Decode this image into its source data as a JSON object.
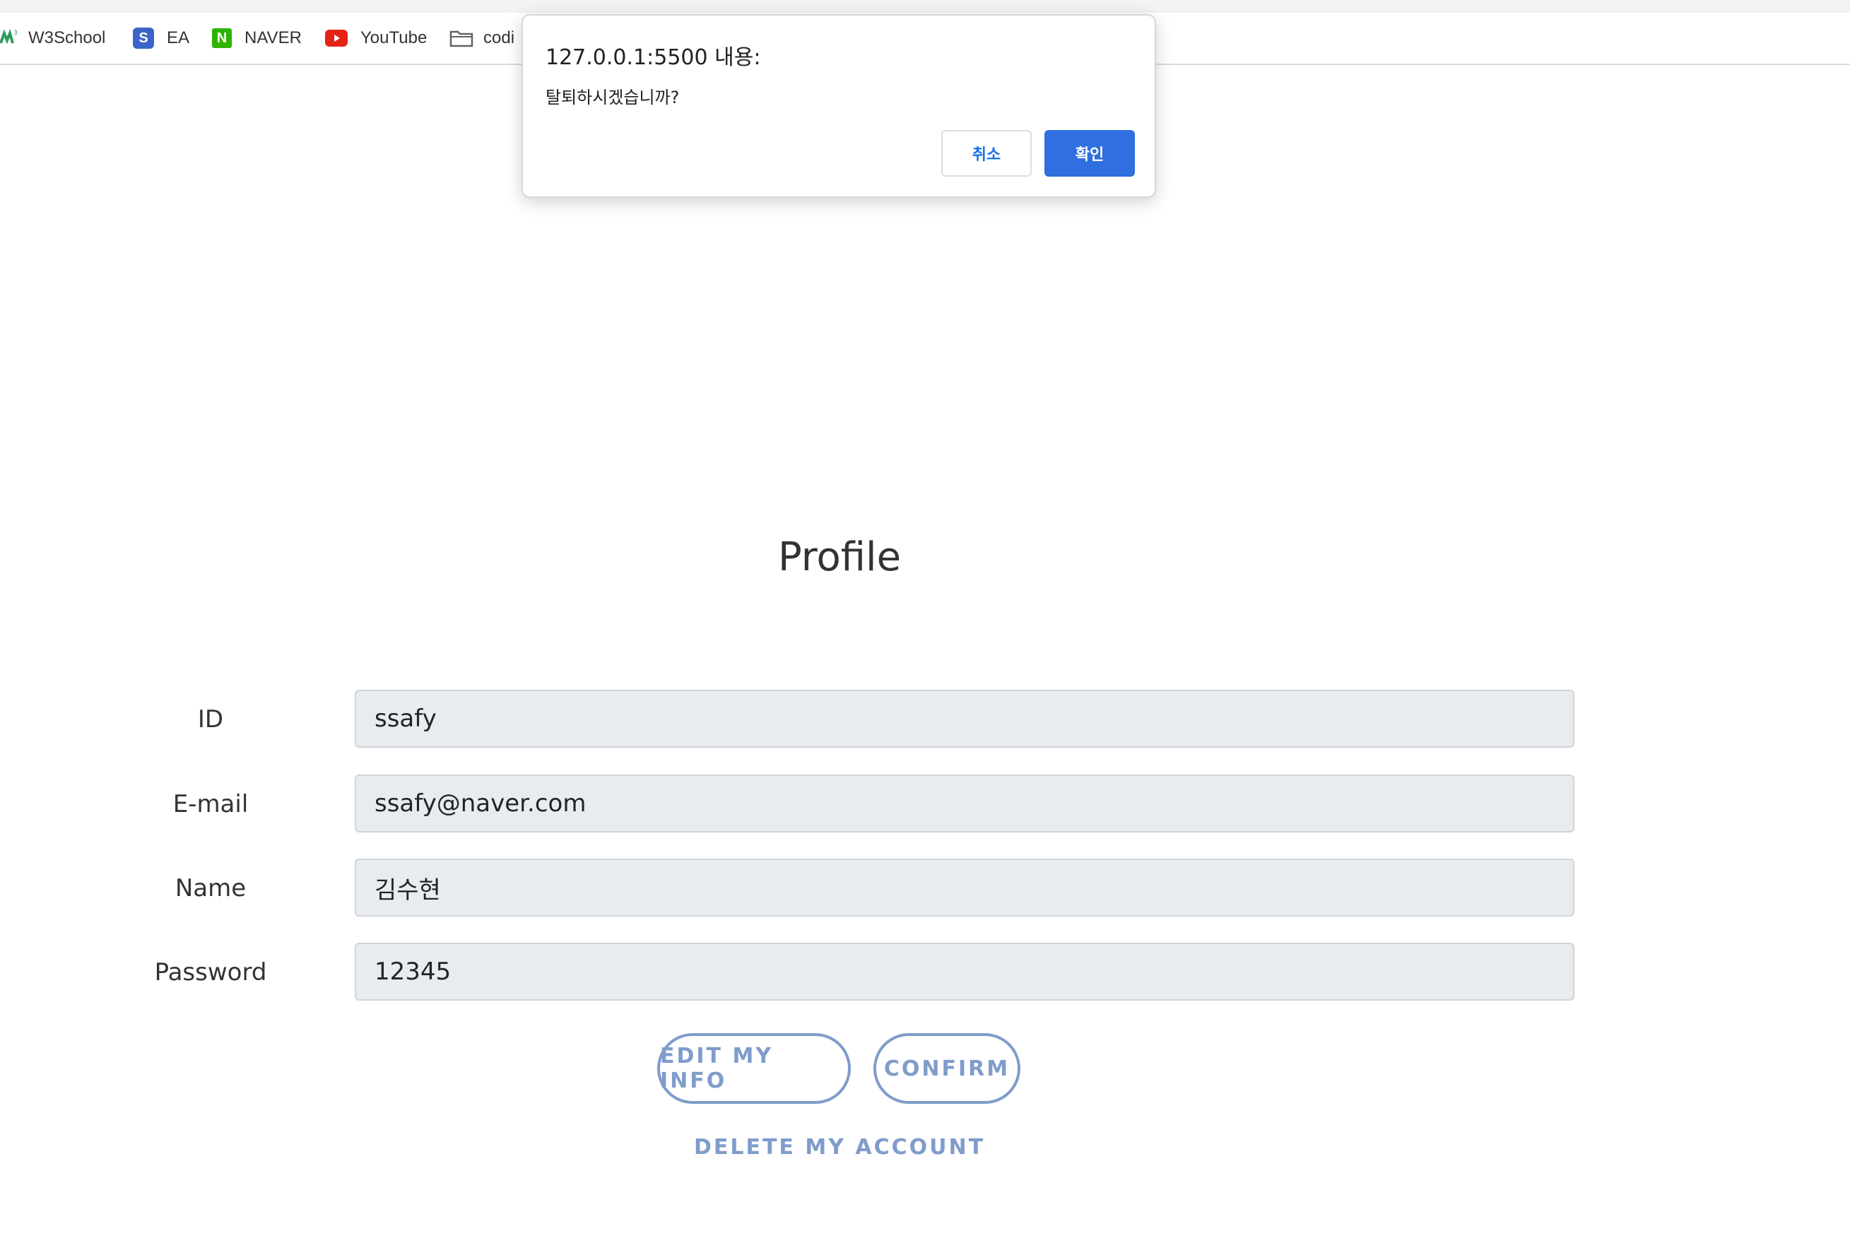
{
  "bookmarks": [
    {
      "label": "W3School",
      "icon": "w3school-icon"
    },
    {
      "label": "EA",
      "icon": "ea-icon",
      "glyph": "S"
    },
    {
      "label": "NAVER",
      "icon": "naver-icon",
      "glyph": "N"
    },
    {
      "label": "YouTube",
      "icon": "youtube-icon"
    },
    {
      "label": "codi",
      "icon": "folder-icon"
    }
  ],
  "dialog": {
    "title": "127.0.0.1:5500 내용:",
    "message": "탈퇴하시겠습니까?",
    "cancel_label": "취소",
    "ok_label": "확인"
  },
  "profile": {
    "title": "Profile",
    "fields": [
      {
        "label": "ID",
        "value": "ssafy"
      },
      {
        "label": "E-mail",
        "value": "ssafy@naver.com"
      },
      {
        "label": "Name",
        "value": "김수현"
      },
      {
        "label": "Password",
        "value": "12345"
      }
    ],
    "edit_label": "EDIT MY INFO",
    "confirm_label": "CONFIRM",
    "delete_label": "DELETE MY ACCOUNT"
  },
  "colors": {
    "accent": "#7f9ccb",
    "dialog_primary": "#2f6fe0",
    "field_bg": "#e9ecef"
  }
}
